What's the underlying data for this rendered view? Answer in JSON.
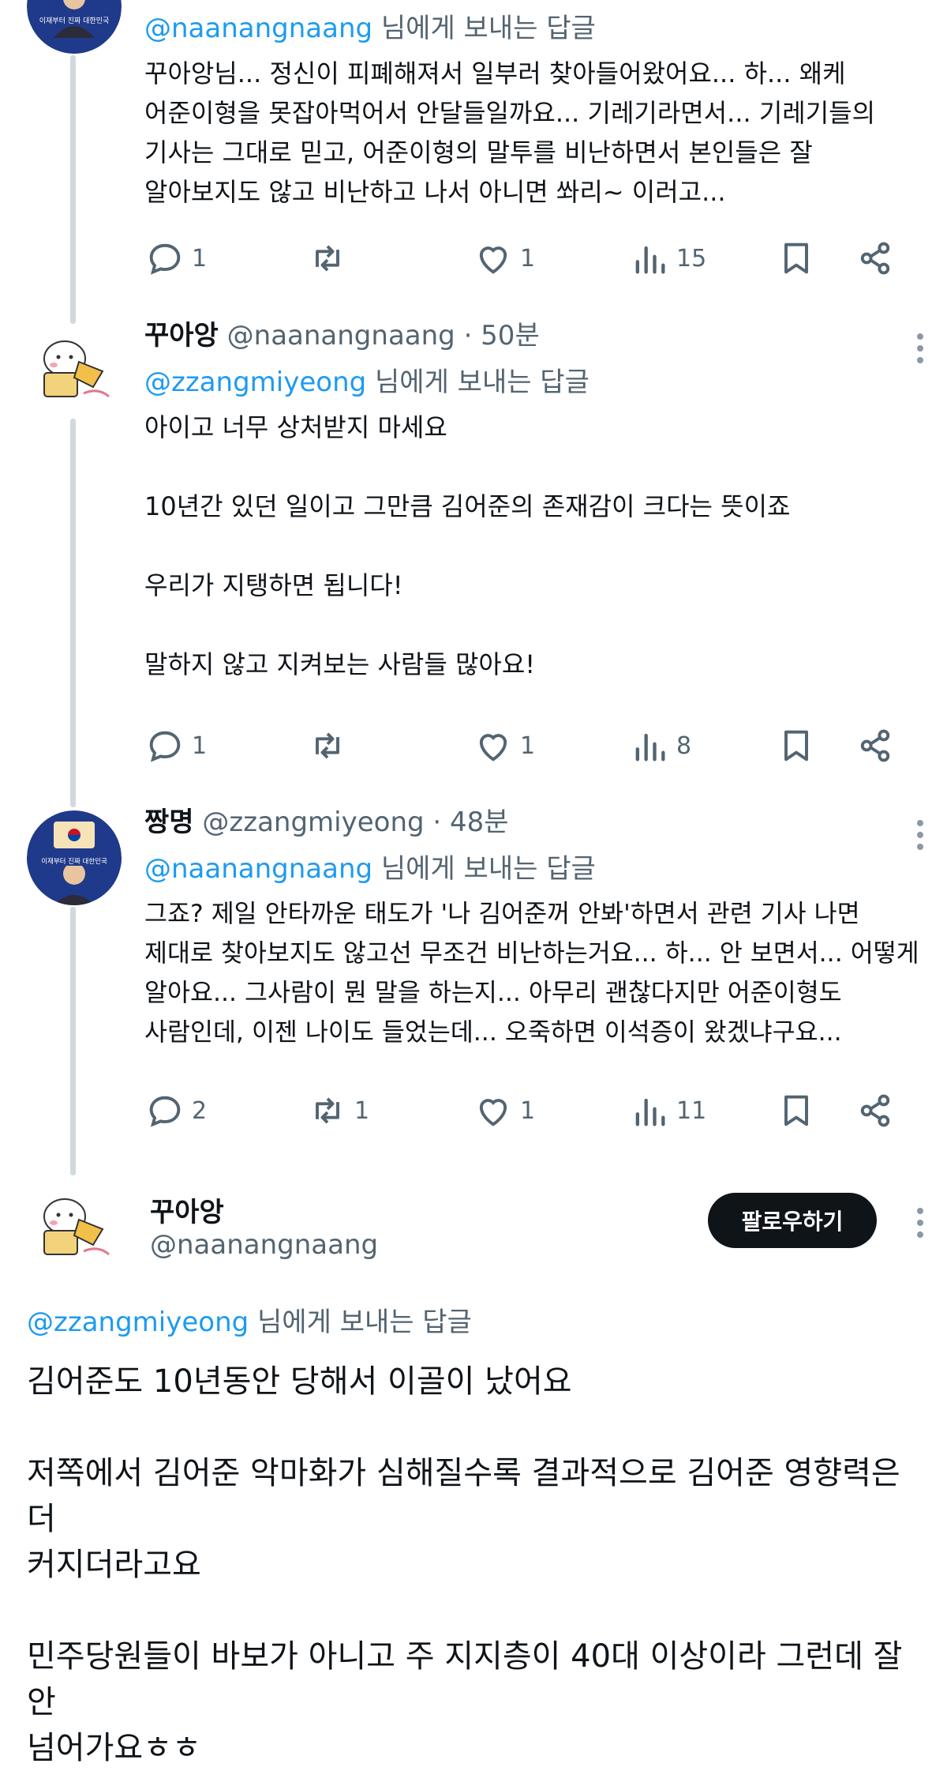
{
  "tweets": [
    {
      "reply_to_handle": "@naanangnaang",
      "reply_suffix": "님에게 보내는 답글",
      "text": "꾸아앙님... 정신이 피폐해져서 일부러 찾아들어왔어요... 하... 왜케\n어준이형을 못잡아먹어서 안달들일까요... 기레기라면서... 기레기들의\n기사는 그대로 믿고, 어준이형의 말투를 비난하면서 본인들은 잘\n알아보지도 않고 비난하고 나서 아니면 쏴리~ 이러고...",
      "replies": "1",
      "retweets": "",
      "likes": "1",
      "views": "15"
    },
    {
      "name": "꾸아앙",
      "handle": "@naanangnaang",
      "time": "· 50분",
      "reply_to_handle": "@zzangmiyeong",
      "reply_suffix": "님에게 보내는 답글",
      "text": "아이고 너무 상처받지 마세요\n\n10년간 있던 일이고 그만큼 김어준의 존재감이 크다는 뜻이죠\n\n우리가 지탱하면 됩니다!\n\n말하지 않고 지켜보는 사람들 많아요!",
      "replies": "1",
      "retweets": "",
      "likes": "1",
      "views": "8"
    },
    {
      "name": "짱명",
      "handle": "@zzangmiyeong",
      "time": "· 48분",
      "reply_to_handle": "@naanangnaang",
      "reply_suffix": "님에게 보내는 답글",
      "text": "그죠? 제일 안타까운 태도가 '나 김어준꺼 안봐'하면서 관련 기사 나면\n제대로 찾아보지도 않고선 무조건 비난하는거요... 하... 안 보면서... 어떻게\n알아요... 그사람이 뭔 말을 하는지... 아무리 괜찮다지만 어준이형도\n사람인데, 이젠 나이도 들었는데... 오죽하면 이석증이 왔겠냐구요...",
      "replies": "2",
      "retweets": "1",
      "likes": "1",
      "views": "11"
    }
  ],
  "avatar_text": "이재부터 진짜 대한민국",
  "main": {
    "name": "꾸아앙",
    "handle": "@naanangnaang",
    "follow_label": "팔로우하기",
    "reply_to_handle": "@zzangmiyeong",
    "reply_suffix": "님에게 보내는 답글",
    "text": "김어준도 10년동안 당해서 이골이 났어요\n\n저쪽에서 김어준 악마화가 심해질수록 결과적으로 김어준 영향력은 더\n커지더라고요\n\n민주당원들이 바보가 아니고 주 지지층이 40대 이상이라 그런데 잘 안\n넘어가요ㅎㅎ"
  },
  "colors": {
    "accent": "#1d9bf0",
    "text": "#0f1419",
    "muted": "#536471",
    "thread_line": "#cfd9de"
  }
}
